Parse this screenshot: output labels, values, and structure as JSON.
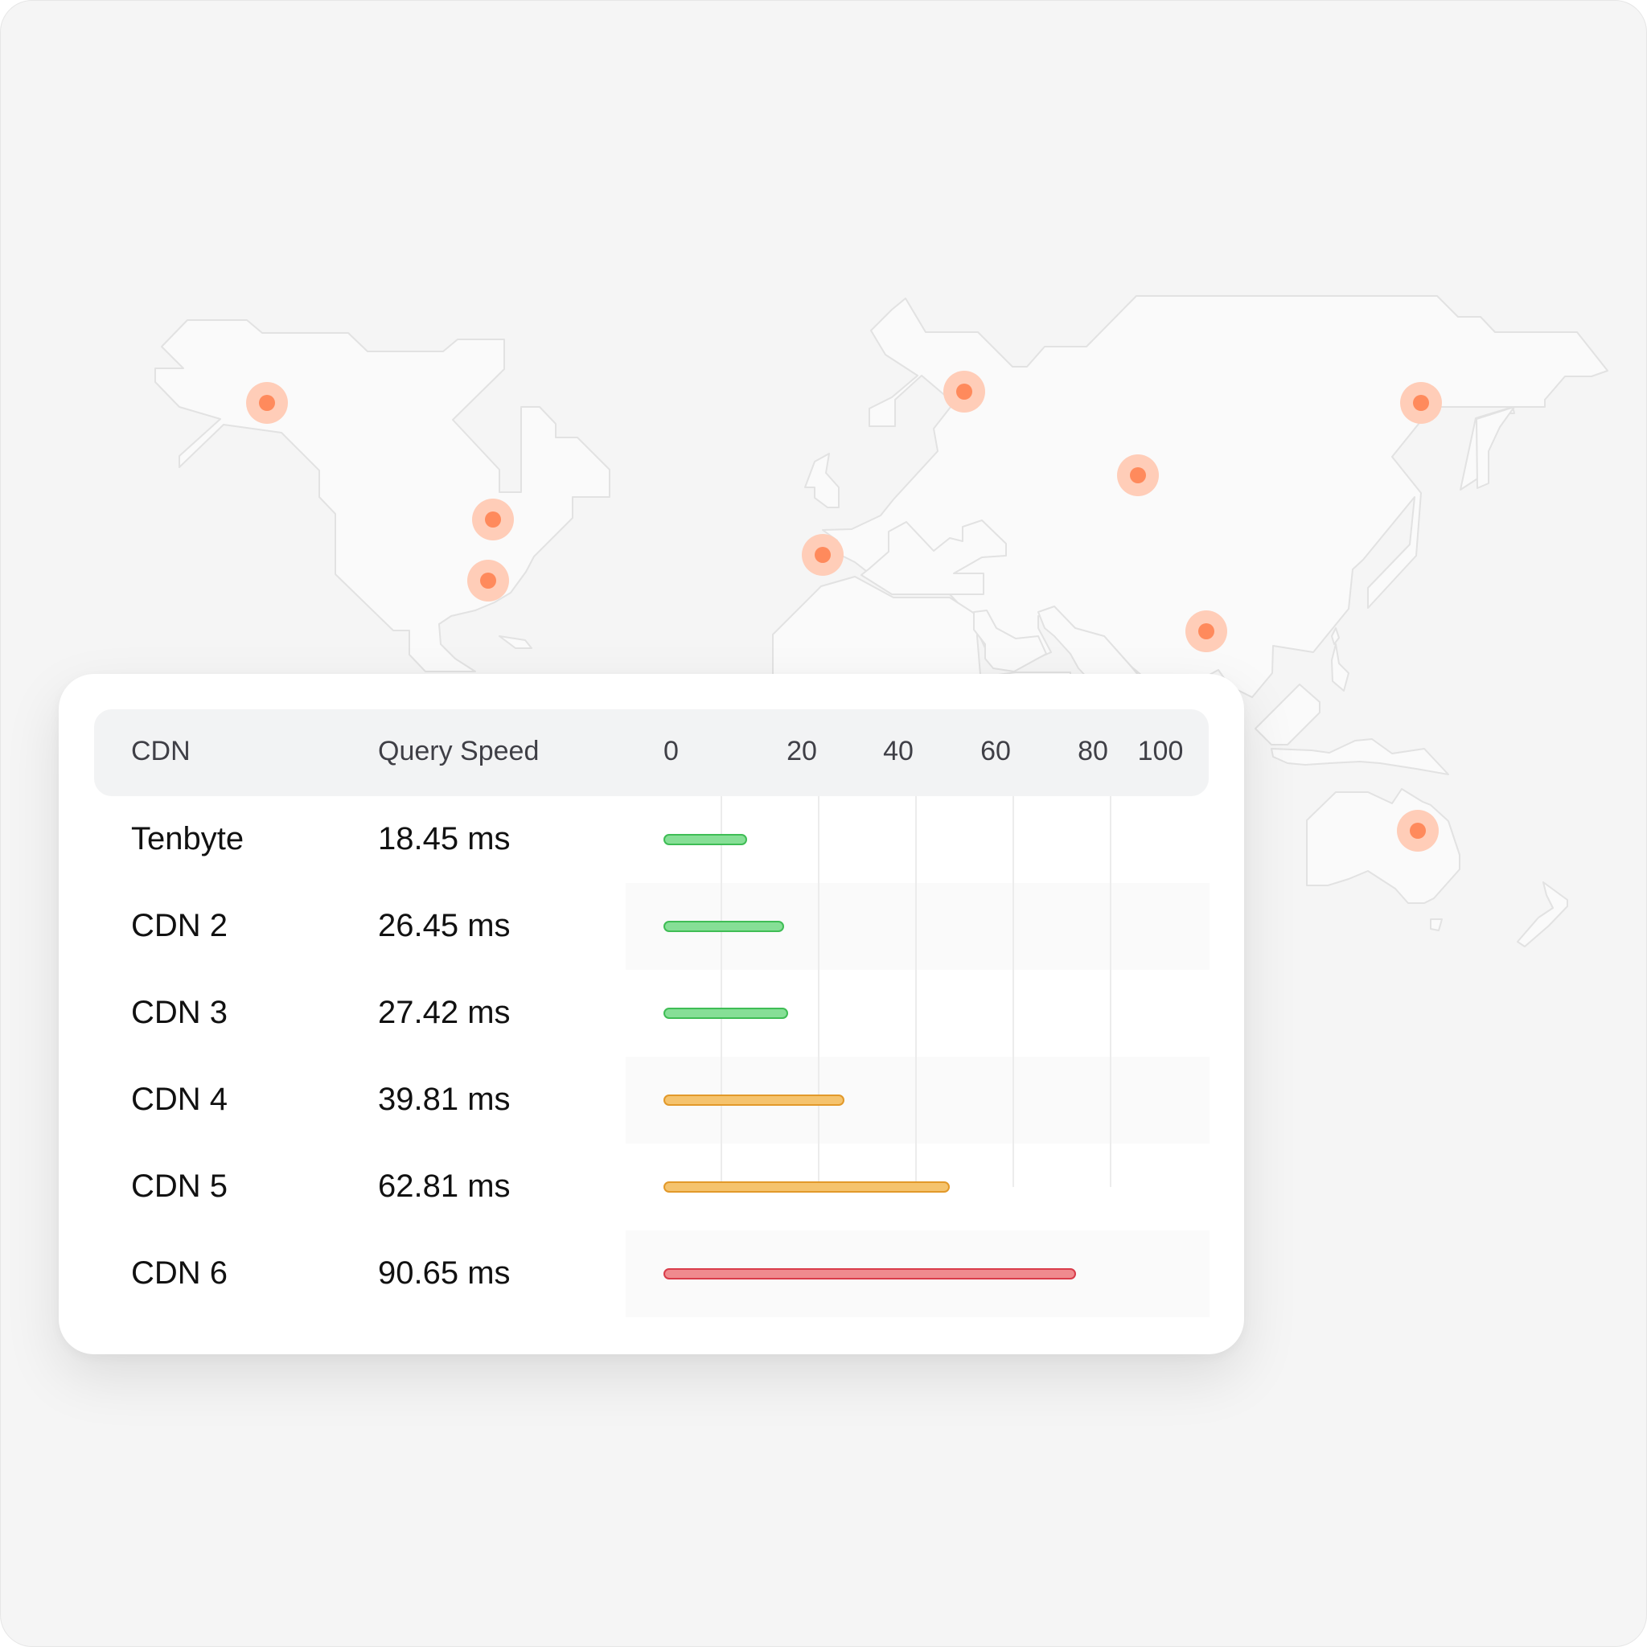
{
  "colors": {
    "fast": "#86df96",
    "fast_border": "#3fbd55",
    "medium": "#f5c36d",
    "medium_border": "#e2992a",
    "slow": "#f08a8e",
    "slow_border": "#d93c4a",
    "marker": "#ff8a5c",
    "marker_halo": "#ffcdb8",
    "land": "#fafafa",
    "land_border": "#e2e2e2"
  },
  "map": {
    "icon": "world-map-icon",
    "marker_count": 11
  },
  "table": {
    "headers": {
      "cdn": "CDN",
      "speed": "Query Speed"
    }
  },
  "chart_data": {
    "type": "bar",
    "orientation": "horizontal",
    "categories": [
      "Tenbyte",
      "CDN 2",
      "CDN 3",
      "CDN 4",
      "CDN 5",
      "CDN 6"
    ],
    "values": [
      18.45,
      26.45,
      27.42,
      39.81,
      62.81,
      90.65
    ],
    "value_labels": [
      "18.45 ms",
      "26.45 ms",
      "27.42 ms",
      "39.81 ms",
      "62.81 ms",
      "90.65 ms"
    ],
    "bar_colors": [
      "fast",
      "fast",
      "fast",
      "medium",
      "medium",
      "slow"
    ],
    "tick_labels": [
      "0",
      "20",
      "40",
      "60",
      "80",
      "100"
    ],
    "xlim": [
      0,
      100
    ],
    "grid": true,
    "legend": "none"
  }
}
